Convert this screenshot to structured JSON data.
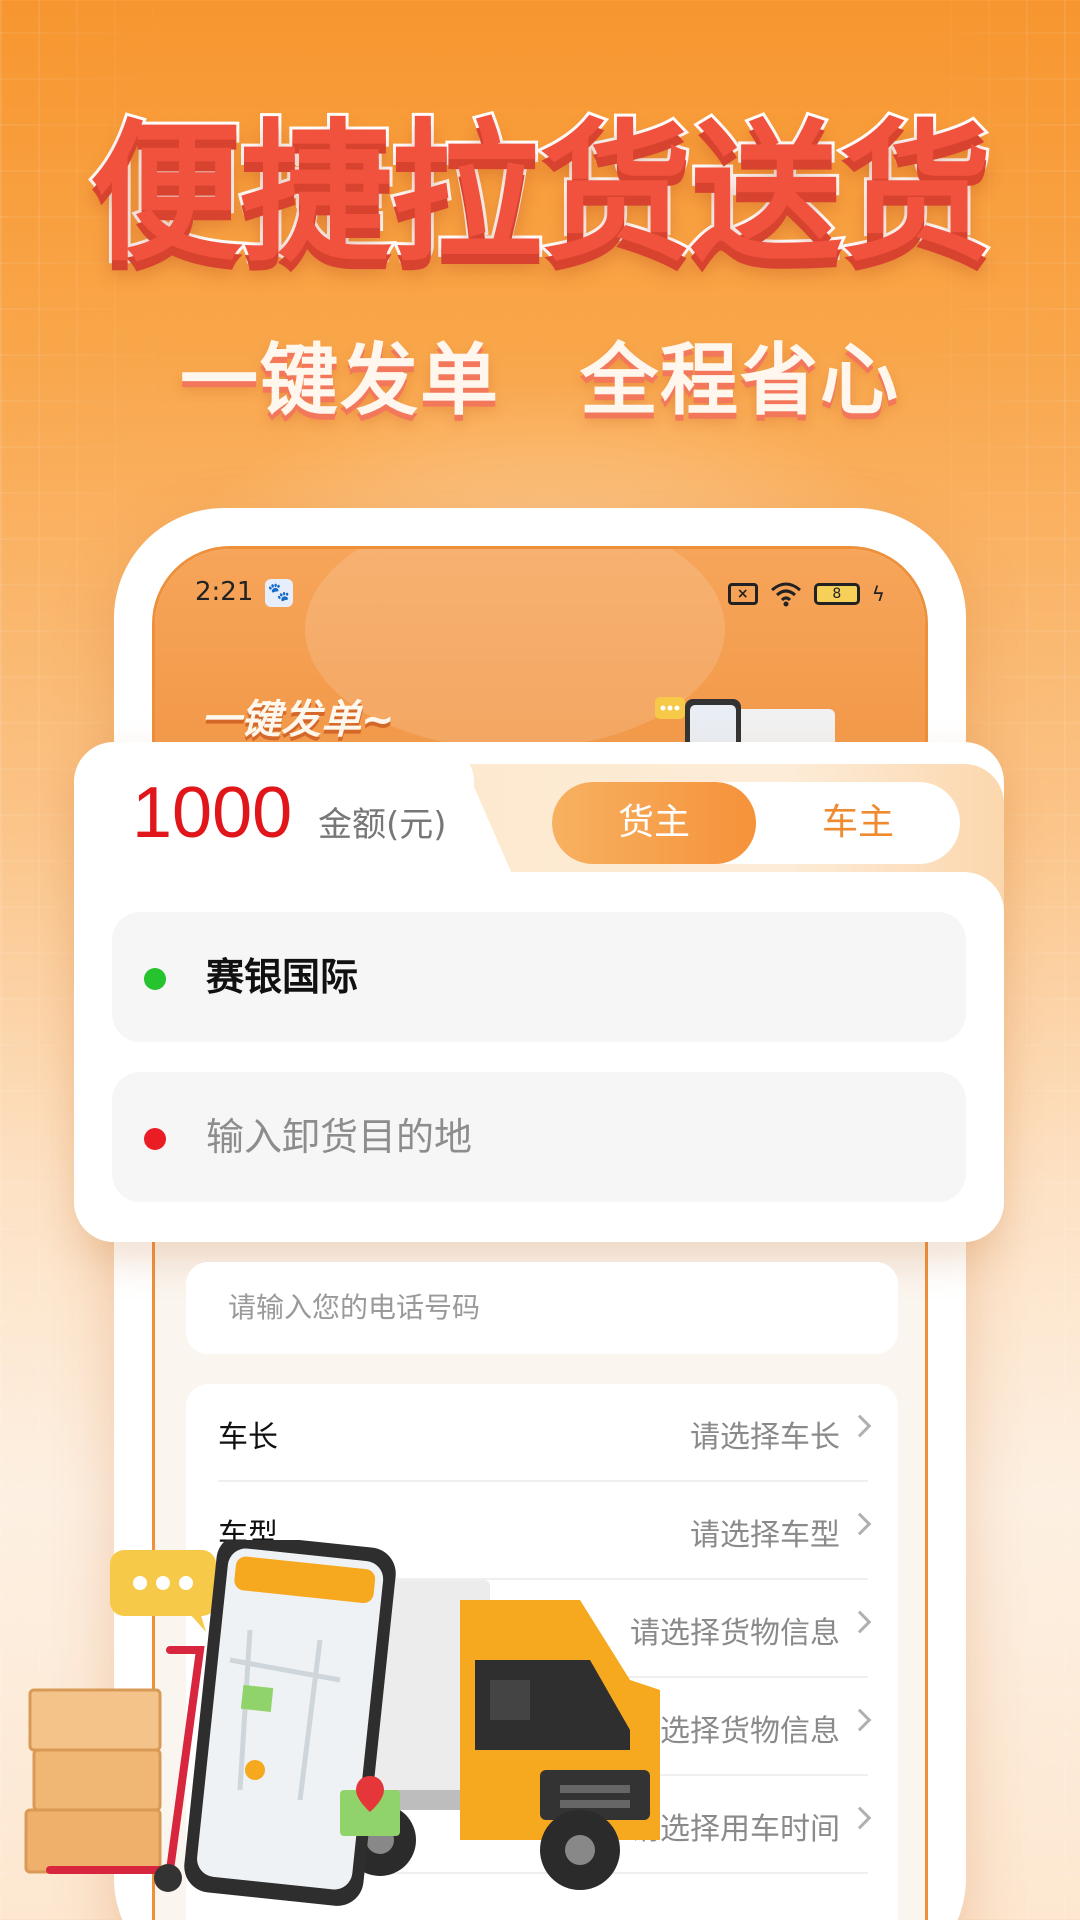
{
  "headline": {
    "title": "便捷拉货送货",
    "sub_left": "一键发单",
    "sub_right": "全程省心"
  },
  "status_bar": {
    "time": "2:21",
    "battery": "8"
  },
  "hero": {
    "text": "一键发单~"
  },
  "order_card": {
    "amount": "1000",
    "amount_label": "金额(元)",
    "toggle": {
      "active": "货主",
      "inactive": "车主"
    },
    "origin": "赛银国际",
    "destination_placeholder": "输入卸货目的地"
  },
  "form": {
    "phone_placeholder": "请输入您的电话号码",
    "rows": [
      {
        "label": "车长",
        "value": "请选择车长"
      },
      {
        "label": "车型",
        "value": "请选择车型"
      },
      {
        "label": "",
        "value": "请选择货物信息"
      },
      {
        "label": "",
        "value": "请选择货物信息"
      },
      {
        "label": "",
        "value": "请选择用车时间"
      }
    ]
  },
  "colors": {
    "accent": "#f6923a",
    "amount": "#e0161b",
    "origin_dot": "#25c32d",
    "destination_dot": "#ea1d24",
    "headline": "#f0523d"
  }
}
